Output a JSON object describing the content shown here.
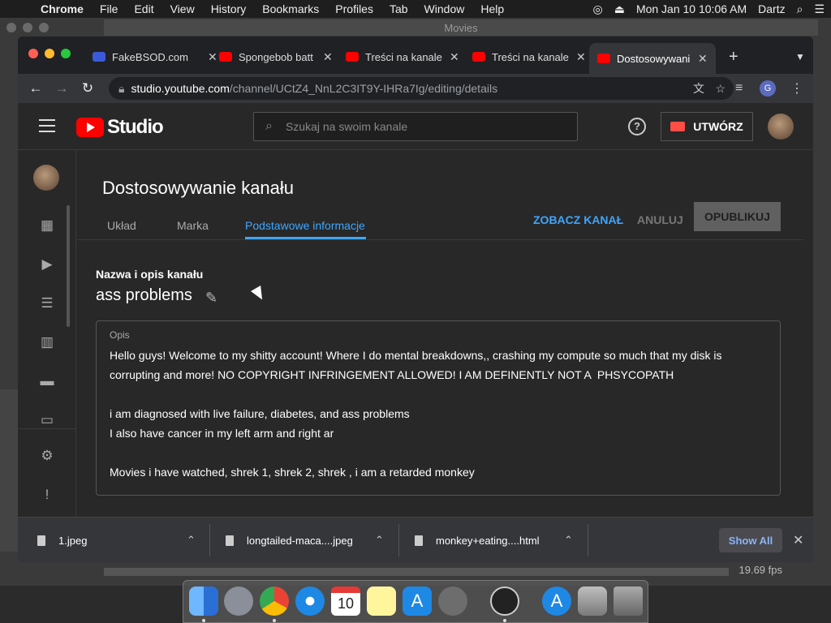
{
  "menubar": {
    "app": "Chrome",
    "items": [
      "File",
      "Edit",
      "View",
      "History",
      "Bookmarks",
      "Profiles",
      "Tab",
      "Window",
      "Help"
    ],
    "clock": "Mon Jan 10  10:06 AM",
    "user": "Dartz"
  },
  "background_app": {
    "window_title": "Movies",
    "fps": "19.69 fps"
  },
  "browser": {
    "tabs": [
      {
        "title": "FakeBSOD.com",
        "favicon_color": "#3a5ad9"
      },
      {
        "title": "Spongebob batt",
        "favicon_color": "#ff0000"
      },
      {
        "title": "Treści na kanale",
        "favicon_color": "#ff0000"
      },
      {
        "title": "Treści na kanale",
        "favicon_color": "#ff0000"
      },
      {
        "title": "Dostosowywani",
        "favicon_color": "#ff0000"
      }
    ],
    "new_tab": "+",
    "url_host": "studio.youtube.com",
    "url_path": "/channel/UCtZ4_NnL2C3IT9Y-IHRa7Ig/editing/details",
    "profile_initial": "G"
  },
  "studio": {
    "logo_text": "Studio",
    "search_placeholder": "Szukaj na swoim kanale",
    "create_label": "UTWÓRZ",
    "page_title": "Dostosowywanie kanału",
    "tabs": [
      "Układ",
      "Marka",
      "Podstawowe informacje"
    ],
    "active_tab": 2,
    "view_channel": "ZOBACZ KANAŁ",
    "cancel": "ANULUJ",
    "publish": "OPUBLIKUJ",
    "section_label": "Nazwa i opis kanału",
    "channel_name": "ass problems",
    "description_label": "Opis",
    "description": "Hello guys! Welcome to my shitty account! Where I do mental breakdowns,, crashing my compute so much that my disk is corrupting and more! NO COPYRIGHT INFRINGEMENT ALLOWED! I AM DEFINENTLY NOT A  PHSYCOPATH\n\ni am diagnosed with live failure, diabetes, and ass problems\nI also have cancer in my left arm and right ar\n\nMovies i have watched, shrek 1, shrek 2, shrek , i am a retarded monkey"
  },
  "downloads": {
    "items": [
      "1.jpeg",
      "longtailed-maca....jpeg",
      "monkey+eating....html"
    ],
    "show_all": "Show All"
  },
  "colors": {
    "accent": "#3ea6ff",
    "youtube_red": "#ff0000",
    "background": "#282828"
  }
}
